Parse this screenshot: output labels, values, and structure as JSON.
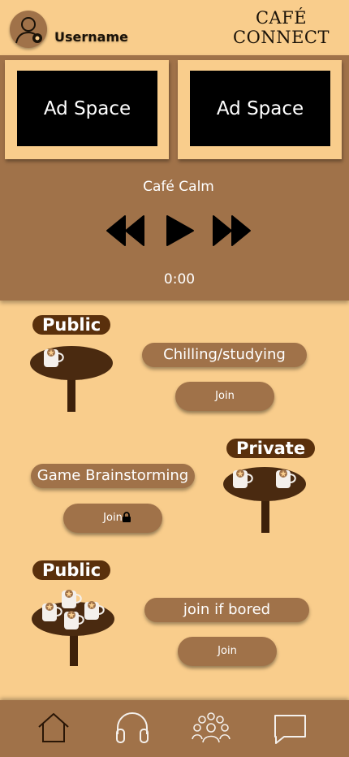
{
  "header": {
    "username": "Username",
    "brand_line1": "CAFÉ",
    "brand_line2": "CONNECT"
  },
  "ads": [
    {
      "label": "Ad Space"
    },
    {
      "label": "Ad Space"
    }
  ],
  "player": {
    "track": "Café Calm",
    "time": "0:00",
    "controls": [
      "rewind-icon",
      "play-icon",
      "fast-forward-icon"
    ]
  },
  "rooms": [
    {
      "visibility": "Public",
      "topic": "Chilling/studying",
      "join_label": "Join",
      "cups": 1,
      "locked": false
    },
    {
      "visibility": "Private",
      "topic": "Game Brainstorming",
      "join_label": "Join",
      "cups": 2,
      "locked": true
    },
    {
      "visibility": "Public",
      "topic": "join if bored",
      "join_label": "Join",
      "cups": 4,
      "locked": false
    }
  ],
  "nav": [
    "home-icon",
    "headphones-icon",
    "group-icon",
    "chat-icon"
  ],
  "colors": {
    "background": "#f9cd8c",
    "panel": "#a07249",
    "dark_brown": "#5a300c",
    "table_top": "#4a2a10"
  }
}
